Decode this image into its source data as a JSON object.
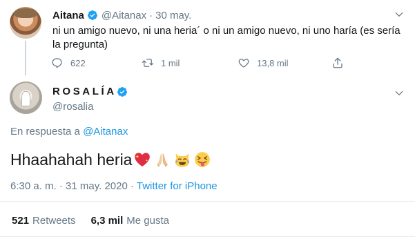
{
  "parent_tweet": {
    "author_name": "Aitana",
    "handle": "@Aitanax",
    "separator": "·",
    "date": "30 may.",
    "text": "ni un amigo nuevo, ni una heria´ o ni un amigo nuevo, ni uno haría (es sería la pregunta)",
    "replies": "622",
    "retweets": "1 mil",
    "likes": "13,8 mil"
  },
  "main_tweet": {
    "author_name": "ROSALÍA",
    "handle": "@rosalia",
    "reply_prefix": "En respuesta a ",
    "reply_handle": "@Aitanax",
    "text": "Hhaahahah heria",
    "emojis": [
      "sparkling-heart",
      "folded-hands",
      "cat-tears-of-joy",
      "squinting-tongue"
    ],
    "timestamp": "6:30 a. m. · 31 may. 2020 · ",
    "source": "Twitter for iPhone",
    "retweet_count": "521",
    "retweet_label": "Retweets",
    "like_count": "6,3 mil",
    "like_label": "Me gusta"
  },
  "icons": {
    "verified": "verified-badge-icon",
    "caret": "chevron-down-icon",
    "reply": "reply-icon",
    "retweet": "retweet-icon",
    "like": "heart-icon",
    "share": "share-icon"
  },
  "colors": {
    "text": "#14171a",
    "muted": "#657786",
    "link": "#1b95e0",
    "verified": "#1da1f2",
    "divider": "#e6ecf0"
  }
}
